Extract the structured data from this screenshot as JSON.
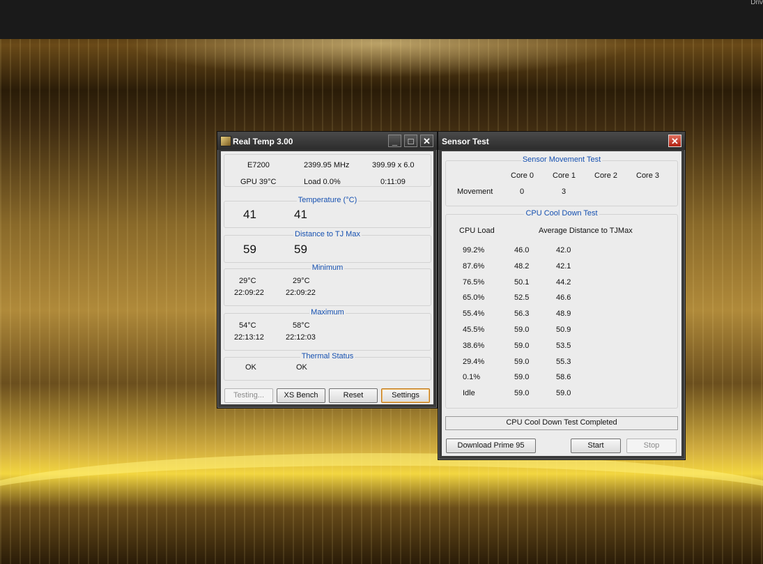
{
  "topbar": {
    "corner_text": "Driv"
  },
  "realtemp": {
    "title": "Real Temp 3.00",
    "info": {
      "cpu": "E7200",
      "freq": "2399.95 MHz",
      "mult": "399.99 x 6.0",
      "gpu": "GPU  39°C",
      "load": "Load   0.0%",
      "time": "0:11:09"
    },
    "temperature": {
      "title": "Temperature (°C)",
      "core0": "41",
      "core1": "41"
    },
    "distance": {
      "title": "Distance to TJ Max",
      "core0": "59",
      "core1": "59"
    },
    "minimum": {
      "title": "Minimum",
      "core0_temp": "29°C",
      "core1_temp": "29°C",
      "core0_time": "22:09:22",
      "core1_time": "22:09:22"
    },
    "maximum": {
      "title": "Maximum",
      "core0_temp": "54°C",
      "core1_temp": "58°C",
      "core0_time": "22:13:12",
      "core1_time": "22:12:03"
    },
    "thermal": {
      "title": "Thermal Status",
      "core0": "OK",
      "core1": "OK"
    },
    "buttons": {
      "testing": "Testing...",
      "xs_bench": "XS Bench",
      "reset": "Reset",
      "settings": "Settings"
    }
  },
  "sensortest": {
    "title": "Sensor Test",
    "movement": {
      "title": "Sensor Movement Test",
      "cores": [
        "Core 0",
        "Core 1",
        "Core 2",
        "Core 3"
      ],
      "row_label": "Movement",
      "values": [
        "0",
        "3"
      ]
    },
    "cooldown": {
      "title": "CPU Cool Down Test",
      "col_load": "CPU Load",
      "col_avg": "Average Distance to TJMax",
      "rows": [
        [
          "99.2%",
          "46.0",
          "42.0"
        ],
        [
          "87.6%",
          "48.2",
          "42.1"
        ],
        [
          "76.5%",
          "50.1",
          "44.2"
        ],
        [
          "65.0%",
          "52.5",
          "46.6"
        ],
        [
          "55.4%",
          "56.3",
          "48.9"
        ],
        [
          "45.5%",
          "59.0",
          "50.9"
        ],
        [
          "38.6%",
          "59.0",
          "53.5"
        ],
        [
          "29.4%",
          "59.0",
          "55.3"
        ],
        [
          "0.1%",
          "59.0",
          "58.6"
        ],
        [
          "Idle",
          "59.0",
          "59.0"
        ]
      ]
    },
    "status": "CPU Cool Down Test Completed",
    "buttons": {
      "download": "Download Prime 95",
      "start": "Start",
      "stop": "Stop"
    }
  }
}
